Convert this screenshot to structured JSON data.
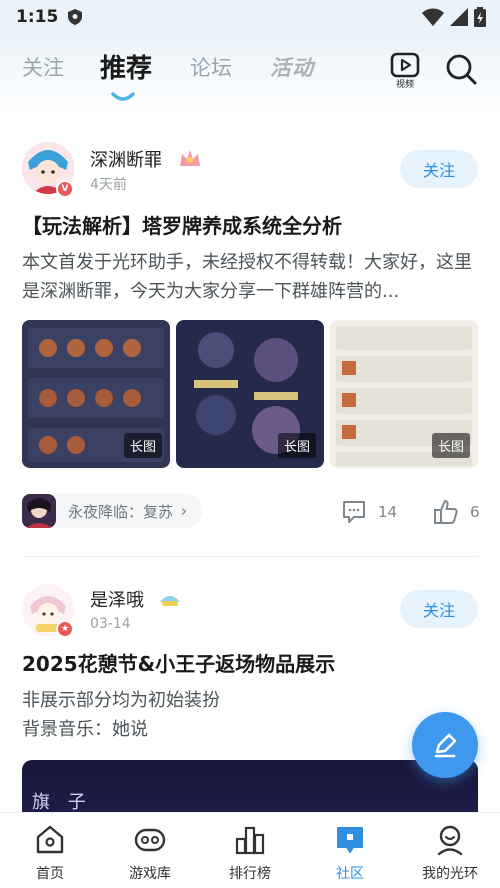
{
  "status_bar": {
    "time": "1:15"
  },
  "top_nav": {
    "tabs": [
      {
        "label": "关注"
      },
      {
        "label": "推荐"
      },
      {
        "label": "论坛"
      },
      {
        "label": "活动"
      }
    ],
    "video_label": "视频"
  },
  "posts": [
    {
      "author": "深渊断罪",
      "time": "4天前",
      "follow_label": "关注",
      "title": "【玩法解析】塔罗牌养成系统全分析",
      "body": "本文首发于光环助手，未经授权不得转载！大家好，这里是深渊断罪，今天为大家分享一下群雄阵营的...",
      "images": [
        {
          "tag": "长图"
        },
        {
          "tag": "长图"
        },
        {
          "tag": "长图"
        }
      ],
      "game": "永夜降临：复苏",
      "comments": "14",
      "likes": "6"
    },
    {
      "author": "是泽哦",
      "time": "03-14",
      "follow_label": "关注",
      "title": "2025花憩节&小王子返场物品展示",
      "body_lines": [
        "非展示部分均为初始装扮",
        "背景音乐：她说"
      ],
      "video_text": "旗 子"
    }
  ],
  "bottom_nav": [
    {
      "label": "首页",
      "icon": "home-icon"
    },
    {
      "label": "游戏库",
      "icon": "gamepad-icon"
    },
    {
      "label": "排行榜",
      "icon": "ranking-icon"
    },
    {
      "label": "社区",
      "icon": "community-icon"
    },
    {
      "label": "我的光环",
      "icon": "profile-icon"
    }
  ],
  "colors": {
    "accent": "#2e8ee0",
    "fab": "#3d98ee",
    "follow_bg": "#e7f3fc"
  }
}
